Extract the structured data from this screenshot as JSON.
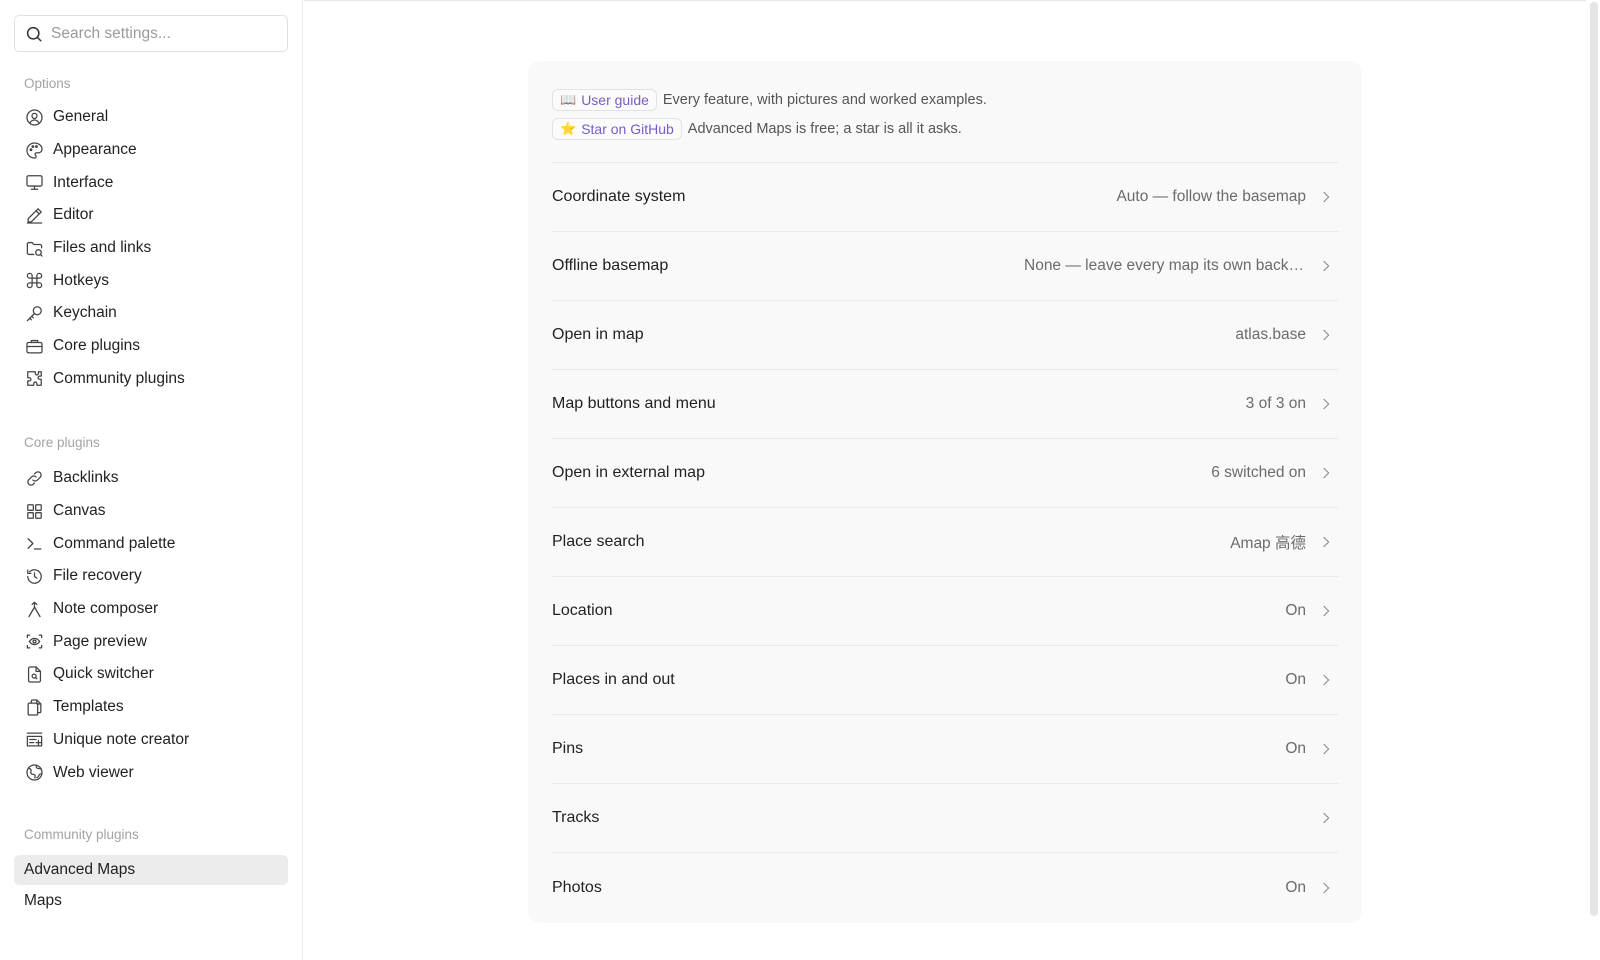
{
  "search": {
    "placeholder": "Search settings..."
  },
  "sidebar": {
    "options_title": "Options",
    "options": [
      {
        "label": "General",
        "icon": "user-circle-icon"
      },
      {
        "label": "Appearance",
        "icon": "palette-icon"
      },
      {
        "label": "Interface",
        "icon": "monitor-icon"
      },
      {
        "label": "Editor",
        "icon": "pencil-icon"
      },
      {
        "label": "Files and links",
        "icon": "folder-icon"
      },
      {
        "label": "Hotkeys",
        "icon": "command-icon"
      },
      {
        "label": "Keychain",
        "icon": "key-icon"
      },
      {
        "label": "Core plugins",
        "icon": "briefcase-icon"
      },
      {
        "label": "Community plugins",
        "icon": "puzzle-icon"
      }
    ],
    "core_title": "Core plugins",
    "core": [
      {
        "label": "Backlinks",
        "icon": "link-icon"
      },
      {
        "label": "Canvas",
        "icon": "grid-icon"
      },
      {
        "label": "Command palette",
        "icon": "terminal-icon"
      },
      {
        "label": "File recovery",
        "icon": "history-icon"
      },
      {
        "label": "Note composer",
        "icon": "merge-icon"
      },
      {
        "label": "Page preview",
        "icon": "eye-scan-icon"
      },
      {
        "label": "Quick switcher",
        "icon": "file-search-icon"
      },
      {
        "label": "Templates",
        "icon": "copy-icon"
      },
      {
        "label": "Unique note creator",
        "icon": "list-plus-icon"
      },
      {
        "label": "Web viewer",
        "icon": "globe-icon"
      }
    ],
    "community_title": "Community plugins",
    "community": [
      {
        "label": "Advanced Maps",
        "active": true
      },
      {
        "label": "Maps",
        "active": false
      }
    ]
  },
  "promo": {
    "guide_emoji": "📖",
    "guide_label": "User guide",
    "guide_text": "Every feature, with pictures and worked examples.",
    "star_emoji": "⭐",
    "star_label": "Star on GitHub",
    "star_text": "Advanced Maps is free; a star is all it asks."
  },
  "settings": [
    {
      "label": "Coordinate system",
      "value": "Auto — follow the basemap"
    },
    {
      "label": "Offline basemap",
      "value": "None — leave every map its own background"
    },
    {
      "label": "Open in map",
      "value": "atlas.base"
    },
    {
      "label": "Map buttons and menu",
      "value": "3 of 3 on"
    },
    {
      "label": "Open in external map",
      "value": "6 switched on"
    },
    {
      "label": "Place search",
      "value": "Amap 高德"
    },
    {
      "label": "Location",
      "value": "On"
    },
    {
      "label": "Places in and out",
      "value": "On"
    },
    {
      "label": "Pins",
      "value": "On"
    },
    {
      "label": "Tracks",
      "value": ""
    },
    {
      "label": "Photos",
      "value": "On"
    }
  ]
}
